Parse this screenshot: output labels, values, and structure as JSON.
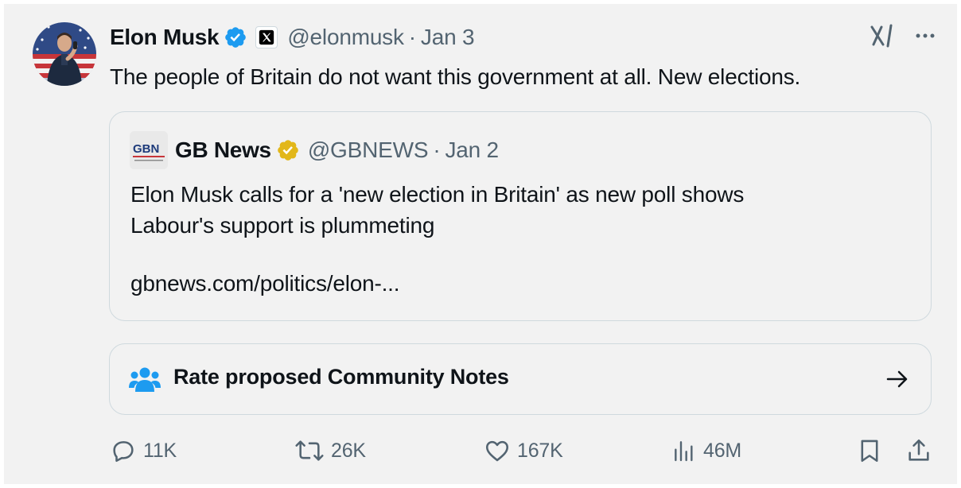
{
  "tweet": {
    "author": {
      "display_name": "Elon Musk",
      "handle": "@elonmusk",
      "date": "Jan 3",
      "separator": "·"
    },
    "text": "The people of Britain do not want this government at all. New elections.",
    "quoted": {
      "display_name": "GB News",
      "handle": "@GBNEWS",
      "date": "Jan 2",
      "separator": "·",
      "logo_text": "GBN",
      "text_line1": "Elon Musk calls for a 'new election in Britain' as new poll shows",
      "text_line2": "Labour's support is plummeting",
      "link": "gbnews.com/politics/elon-..."
    },
    "community_notes": {
      "label": "Rate proposed Community Notes"
    },
    "metrics": {
      "replies": "11K",
      "reposts": "26K",
      "likes": "167K",
      "views": "46M"
    }
  },
  "icons": {
    "verified_badge": "verified-badge-icon",
    "affiliate_badge": "x-logo-icon",
    "grok": "grok-icon",
    "more": "more-icon",
    "gold_badge": "gold-verified-badge-icon",
    "community": "community-notes-icon",
    "arrow": "arrow-right-icon",
    "reply": "reply-icon",
    "repost": "repost-icon",
    "like": "like-icon",
    "views": "views-icon",
    "bookmark": "bookmark-icon",
    "share": "share-icon"
  },
  "colors": {
    "blue_verified": "#1d9bf0",
    "gold_verified": "#e2b719",
    "muted_text": "#536471",
    "primary_text": "#0f1419",
    "border": "#cfd9de",
    "background": "#f2f2f2"
  }
}
